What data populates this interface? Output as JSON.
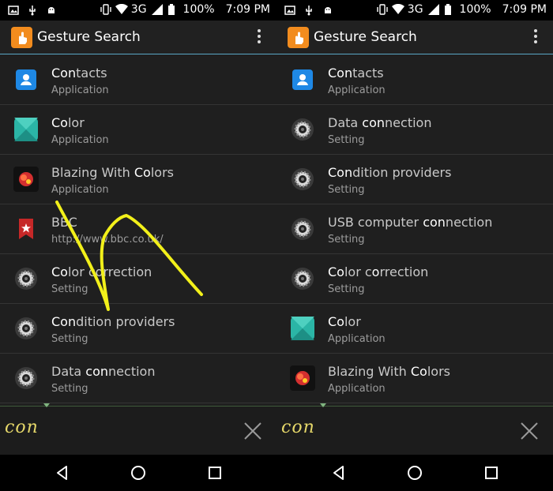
{
  "status_bar": {
    "battery": "100%",
    "time": "7:09 PM",
    "network": "3G"
  },
  "app": {
    "title": "Gesture Search"
  },
  "panels": [
    {
      "query": "con",
      "results": [
        {
          "icon": "contacts-icon",
          "parts": [
            {
              "t": "Co",
              "h": true
            },
            {
              "t": "n",
              "h": true
            },
            {
              "t": "tacts",
              "h": false
            }
          ],
          "title": "Contacts",
          "subtitle": "Application"
        },
        {
          "icon": "color-app-icon",
          "parts": [
            {
              "t": "Co",
              "h": true
            },
            {
              "t": "lor",
              "h": false
            }
          ],
          "title": "Color",
          "subtitle": "Application"
        },
        {
          "icon": "blazing-colors-icon",
          "parts": [
            {
              "t": "Blazing With ",
              "h": false
            },
            {
              "t": "Co",
              "h": true
            },
            {
              "t": "lors",
              "h": false
            }
          ],
          "title": "Blazing With Colors",
          "subtitle": "Application"
        },
        {
          "icon": "bbc-icon",
          "parts": [
            {
              "t": "BBC",
              "h": false
            }
          ],
          "title": "BBC",
          "subtitle": "http://www.bbc.co.uk/"
        },
        {
          "icon": "settings-gear-icon",
          "parts": [
            {
              "t": "Co",
              "h": true
            },
            {
              "t": "lor ",
              "h": false
            },
            {
              "t": "c",
              "h": false
            },
            {
              "t": "orrection",
              "h": false
            }
          ],
          "title": "Color correction",
          "subtitle": "Setting"
        },
        {
          "icon": "settings-gear-icon",
          "parts": [
            {
              "t": "Con",
              "h": true
            },
            {
              "t": "dition providers",
              "h": false
            }
          ],
          "title": "Condition providers",
          "subtitle": "Setting"
        },
        {
          "icon": "settings-gear-icon",
          "parts": [
            {
              "t": "Data ",
              "h": false
            },
            {
              "t": "con",
              "h": true
            },
            {
              "t": "nection",
              "h": false
            }
          ],
          "title": "Data connection",
          "subtitle": "Setting"
        }
      ]
    },
    {
      "query": "con",
      "results": [
        {
          "icon": "contacts-icon",
          "parts": [
            {
              "t": "Con",
              "h": true
            },
            {
              "t": "tacts",
              "h": false
            }
          ],
          "title": "Contacts",
          "subtitle": "Application"
        },
        {
          "icon": "settings-gear-icon",
          "parts": [
            {
              "t": "Data ",
              "h": false
            },
            {
              "t": "con",
              "h": true
            },
            {
              "t": "nection",
              "h": false
            }
          ],
          "title": "Data connection",
          "subtitle": "Setting"
        },
        {
          "icon": "settings-gear-icon",
          "parts": [
            {
              "t": "Con",
              "h": true
            },
            {
              "t": "dition providers",
              "h": false
            }
          ],
          "title": "Condition providers",
          "subtitle": "Setting"
        },
        {
          "icon": "settings-gear-icon",
          "parts": [
            {
              "t": "USB computer ",
              "h": false
            },
            {
              "t": "con",
              "h": true
            },
            {
              "t": "nection",
              "h": false
            }
          ],
          "title": "USB computer connection",
          "subtitle": "Setting"
        },
        {
          "icon": "settings-gear-icon",
          "parts": [
            {
              "t": "Co",
              "h": true
            },
            {
              "t": "lor ",
              "h": false
            },
            {
              "t": "c",
              "h": false
            },
            {
              "t": "o",
              "h": true
            },
            {
              "t": "rrection",
              "h": false
            }
          ],
          "title": "Color correction",
          "subtitle": "Setting"
        },
        {
          "icon": "color-app-icon",
          "parts": [
            {
              "t": "Co",
              "h": true
            },
            {
              "t": "lor",
              "h": false
            }
          ],
          "title": "Color",
          "subtitle": "Application"
        },
        {
          "icon": "blazing-colors-icon",
          "parts": [
            {
              "t": "Blazing With ",
              "h": false
            },
            {
              "t": "Co",
              "h": true
            },
            {
              "t": "lors",
              "h": false
            }
          ],
          "title": "Blazing With Colors",
          "subtitle": "Application"
        }
      ]
    }
  ],
  "colors": {
    "accent_line": "#5aa6c6",
    "gesture_stroke": "#f2f01a",
    "app_icon": "#f28c1e",
    "query_text": "#e6d86a"
  }
}
